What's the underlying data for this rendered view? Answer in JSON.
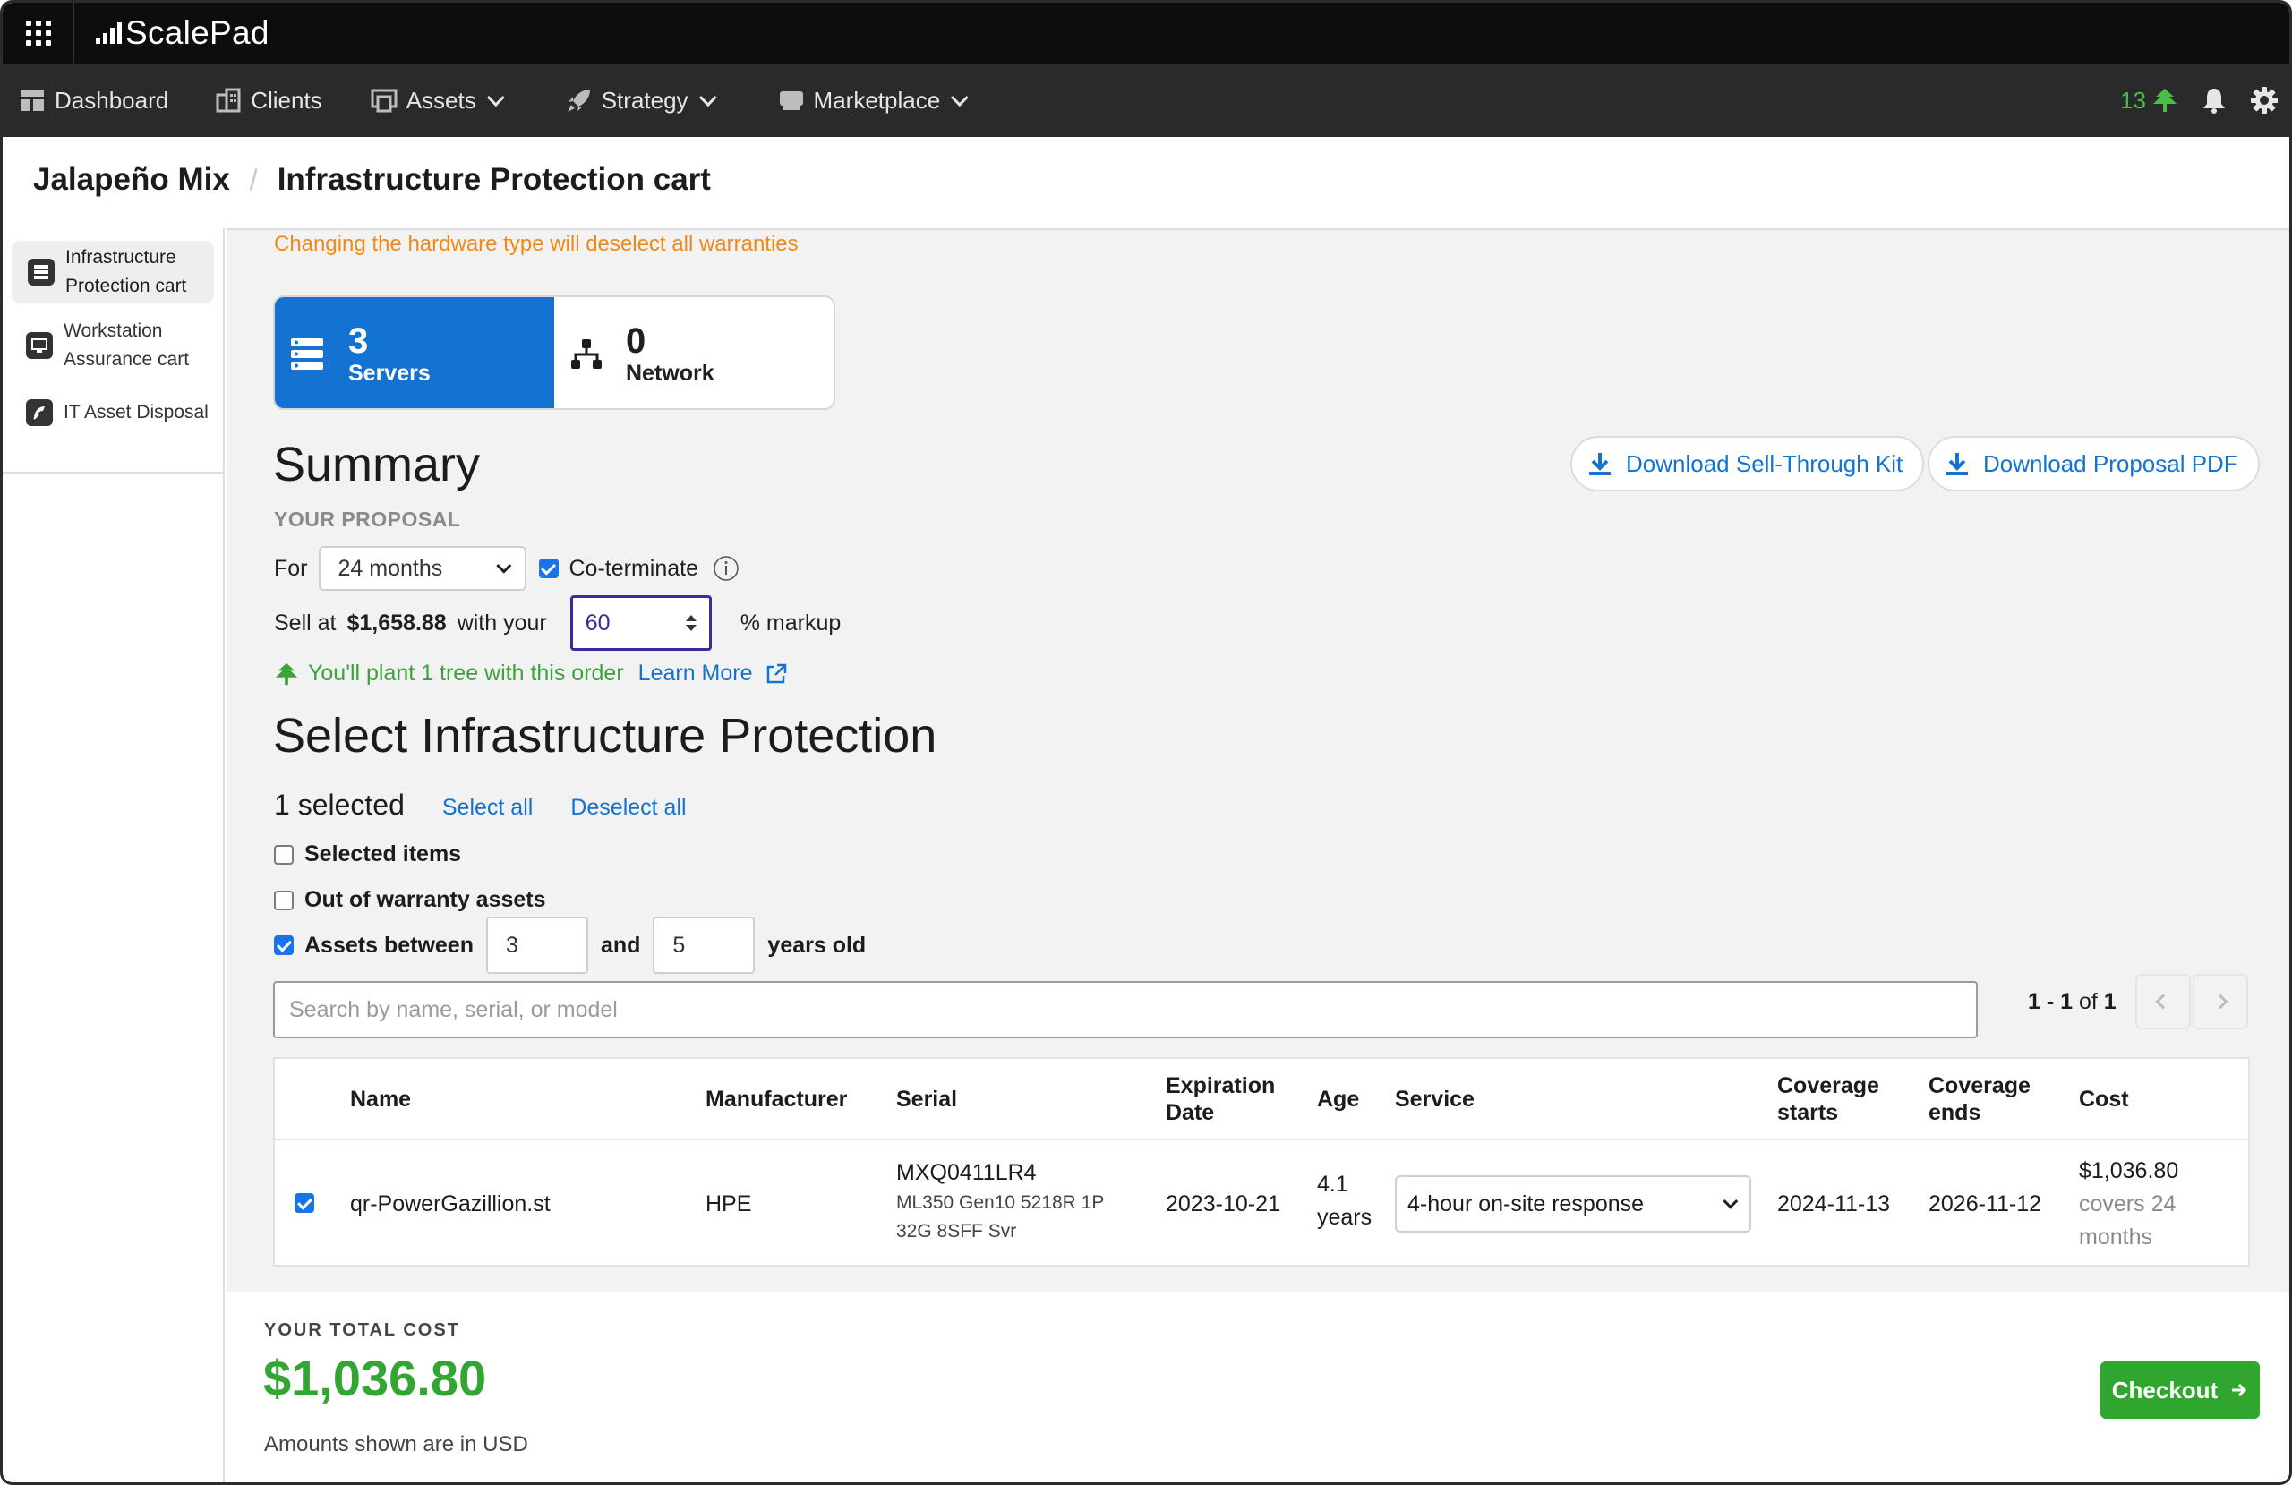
{
  "brand": {
    "name": "ScalePad"
  },
  "nav": {
    "items": [
      {
        "label": "Dashboard",
        "icon": "dashboard-icon",
        "dropdown": false
      },
      {
        "label": "Clients",
        "icon": "clients-icon",
        "dropdown": false
      },
      {
        "label": "Assets",
        "icon": "assets-icon",
        "dropdown": true
      },
      {
        "label": "Strategy",
        "icon": "rocket-icon",
        "dropdown": true
      },
      {
        "label": "Marketplace",
        "icon": "marketplace-icon",
        "dropdown": true
      }
    ],
    "tree_count": "13"
  },
  "breadcrumb": {
    "client": "Jalapeño Mix",
    "page": "Infrastructure Protection cart"
  },
  "sidebar": {
    "items": [
      {
        "line1": "Infrastructure",
        "line2": "Protection cart",
        "active": true
      },
      {
        "line1": "Workstation",
        "line2": "Assurance cart",
        "active": false
      },
      {
        "line1": "IT Asset Disposal",
        "line2": "",
        "active": false
      }
    ]
  },
  "warning": "Changing the hardware type will deselect all warranties",
  "hardware_tabs": [
    {
      "count": "3",
      "label": "Servers",
      "selected": true
    },
    {
      "count": "0",
      "label": "Network",
      "selected": false
    }
  ],
  "summary": {
    "title": "Summary",
    "download_kit": "Download Sell-Through Kit",
    "download_pdf": "Download Proposal PDF",
    "proposal_caption": "YOUR PROPOSAL",
    "for_label": "For",
    "term": "24 months",
    "coterminate_label": "Co-terminate",
    "coterminate_checked": true,
    "sell_at_label": "Sell at",
    "sell_price": "$1,658.88",
    "with_your_label": "with your",
    "markup_value": "60",
    "markup_suffix": "% markup",
    "tree_note": "You'll plant 1 tree with this order",
    "learn_more": "Learn More"
  },
  "selection": {
    "title": "Select Infrastructure Protection",
    "count_text": "1 selected",
    "select_all": "Select all",
    "deselect_all": "Deselect all",
    "filters": {
      "selected_items": {
        "label": "Selected items",
        "checked": false
      },
      "out_of_warranty": {
        "label": "Out of warranty assets",
        "checked": false
      },
      "assets_between": {
        "label": "Assets between",
        "checked": true,
        "from": "3",
        "and_label": "and",
        "to": "5",
        "suffix": "years old"
      }
    },
    "search_placeholder": "Search by name, serial, or model",
    "pager": {
      "range": "1 - 1",
      "of_label": "of",
      "total": "1"
    }
  },
  "table": {
    "headers": {
      "name": "Name",
      "manufacturer": "Manufacturer",
      "serial": "Serial",
      "expiration_l1": "Expiration",
      "expiration_l2": "Date",
      "age": "Age",
      "service": "Service",
      "cov_start_l1": "Coverage",
      "cov_start_l2": "starts",
      "cov_end_l1": "Coverage",
      "cov_end_l2": "ends",
      "cost": "Cost"
    },
    "rows": [
      {
        "checked": true,
        "name": "qr-PowerGazillion.st",
        "manufacturer": "HPE",
        "serial": "MXQ0411LR4",
        "model_l1": "ML350 Gen10 5218R 1P",
        "model_l2": "32G 8SFF Svr",
        "expiration": "2023-10-21",
        "age_l1": "4.1",
        "age_l2": "years",
        "service": "4-hour on-site response",
        "coverage_start": "2024-11-13",
        "coverage_end": "2026-11-12",
        "cost": "$1,036.80",
        "cost_l2": "covers 24",
        "cost_l3": "months"
      }
    ]
  },
  "footer": {
    "total_caption": "YOUR TOTAL COST",
    "total": "$1,036.80",
    "currency_note": "Amounts shown are in USD",
    "checkout": "Checkout"
  },
  "colors": {
    "primary": "#1473d2",
    "success": "#33a532",
    "warning": "#ef8a1a",
    "topbar": "#0d0d0d",
    "navbar": "#2a2a2a"
  }
}
